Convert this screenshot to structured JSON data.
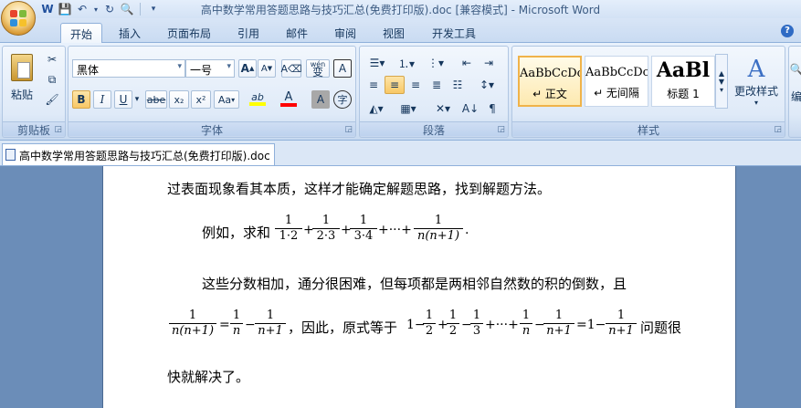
{
  "window": {
    "title": "高中数学常用答题思路与技巧汇总(免费打印版).doc [兼容模式] - Microsoft Word"
  },
  "ribbon_tabs": [
    "开始",
    "插入",
    "页面布局",
    "引用",
    "邮件",
    "审阅",
    "视图",
    "开发工具"
  ],
  "clipboard": {
    "paste_label": "粘贴",
    "group_label": "剪贴板"
  },
  "font": {
    "font_name": "黑体",
    "font_size": "一号",
    "group_label": "字体",
    "bold": "B",
    "italic": "I",
    "underline": "U",
    "strike": "abe",
    "subscript": "x₂",
    "superscript": "x²",
    "change_case": "Aa",
    "phonetic": "wén",
    "change_style": "变",
    "grow": "A",
    "shrink": "A",
    "char_border": "A",
    "char_shading": "A",
    "enclose": "字",
    "font_color": "A",
    "highlight": "ab"
  },
  "paragraph": {
    "group_label": "段落"
  },
  "styles": {
    "group_label": "样式",
    "change_styles": "更改样式",
    "items": [
      {
        "sample": "AaBbCcDc",
        "name": "↵ 正文"
      },
      {
        "sample": "AaBbCcDc",
        "name": "↵ 无间隔"
      },
      {
        "sample": "AaBl",
        "name": "标题 1"
      }
    ],
    "edit_partial": "编"
  },
  "doc_tab": "高中数学常用答题思路与技巧汇总(免费打印版).doc",
  "document": {
    "line1": "过表面现象看其本质，这样才能确定解题思路，找到解题方法。",
    "example_prefix": "例如，求和",
    "line3": "这些分数相加，通分很困难，但每项都是两相邻自然数的积的倒数，且",
    "line4_mid": "，因此，原式等于",
    "line4_end": "问题很",
    "line5": "快就解决了。",
    "frac_example": [
      {
        "n": "1",
        "d": "1·2"
      },
      {
        "n": "1",
        "d": "2·3"
      },
      {
        "n": "1",
        "d": "3·4"
      },
      {
        "n": "1",
        "d": "n(n+1)"
      }
    ],
    "ops_example": [
      "+",
      "+",
      "+···+",
      "."
    ],
    "identity": [
      {
        "n": "1",
        "d": "n(n+1)"
      },
      {
        "n": "1",
        "d": "n"
      },
      {
        "n": "1",
        "d": "n+1"
      }
    ],
    "ops_identity": [
      "=",
      "−"
    ],
    "result_fracs": [
      {
        "n": "1",
        "d": "2"
      },
      {
        "n": "1",
        "d": "2"
      },
      {
        "n": "1",
        "d": "3"
      },
      {
        "n": "1",
        "d": "n"
      },
      {
        "n": "1",
        "d": "n+1"
      },
      {
        "n": "1",
        "d": "n+1"
      }
    ],
    "ops_result": [
      "1−",
      "+",
      "−",
      "+···+",
      "−",
      "=1−"
    ]
  }
}
